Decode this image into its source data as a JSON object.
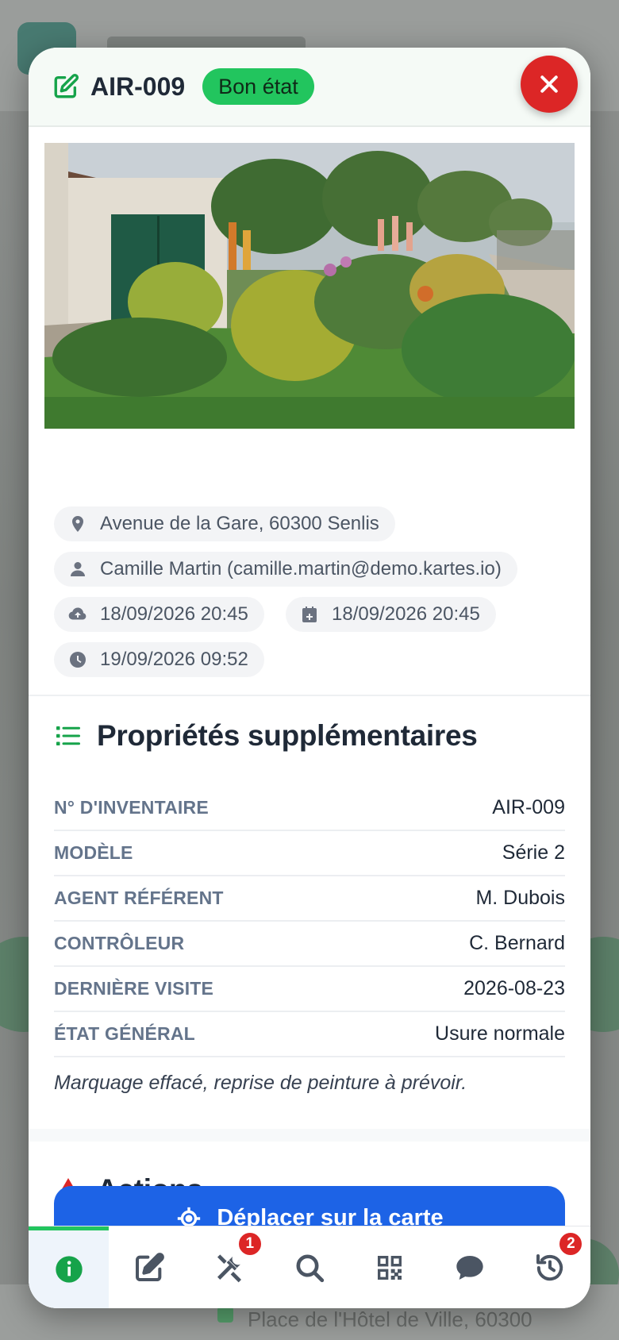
{
  "asset": {
    "code": "AIR-009",
    "status": "Bon état"
  },
  "meta": {
    "address": "Avenue de la Gare, 60300 Senlis",
    "user": "Camille Martin (camille.martin@demo.kartes.io)",
    "uploaded": "18/09/2026 20:45",
    "created": "18/09/2026 20:45",
    "updated": "19/09/2026 09:52"
  },
  "properties": {
    "title": "Propriétés supplémentaires",
    "rows": [
      {
        "key": "N° D'INVENTAIRE",
        "value": "AIR-009"
      },
      {
        "key": "MODÈLE",
        "value": "Série 2"
      },
      {
        "key": "AGENT RÉFÉRENT",
        "value": "M. Dubois"
      },
      {
        "key": "CONTRÔLEUR",
        "value": "C. Bernard"
      },
      {
        "key": "DERNIÈRE VISITE",
        "value": "2026-08-23"
      },
      {
        "key": "ÉTAT GÉNÉRAL",
        "value": "Usure normale"
      }
    ],
    "note": "Marquage effacé, reprise de peinture à prévoir."
  },
  "actions": {
    "title": "Actions",
    "move_label": "Déplacer sur la carte"
  },
  "nav": {
    "items": [
      {
        "icon": "info-icon",
        "badge": ""
      },
      {
        "icon": "edit-icon",
        "badge": ""
      },
      {
        "icon": "tools-icon",
        "badge": "1"
      },
      {
        "icon": "search-icon",
        "badge": ""
      },
      {
        "icon": "qr-code-icon",
        "badge": ""
      },
      {
        "icon": "comment-icon",
        "badge": ""
      },
      {
        "icon": "history-icon",
        "badge": "2"
      }
    ]
  },
  "background": {
    "list_item": "Place de l'Hôtel de Ville, 60300"
  },
  "colors": {
    "accent_green": "#22c55e",
    "danger_red": "#dc2626",
    "primary_blue": "#1d63e6"
  }
}
